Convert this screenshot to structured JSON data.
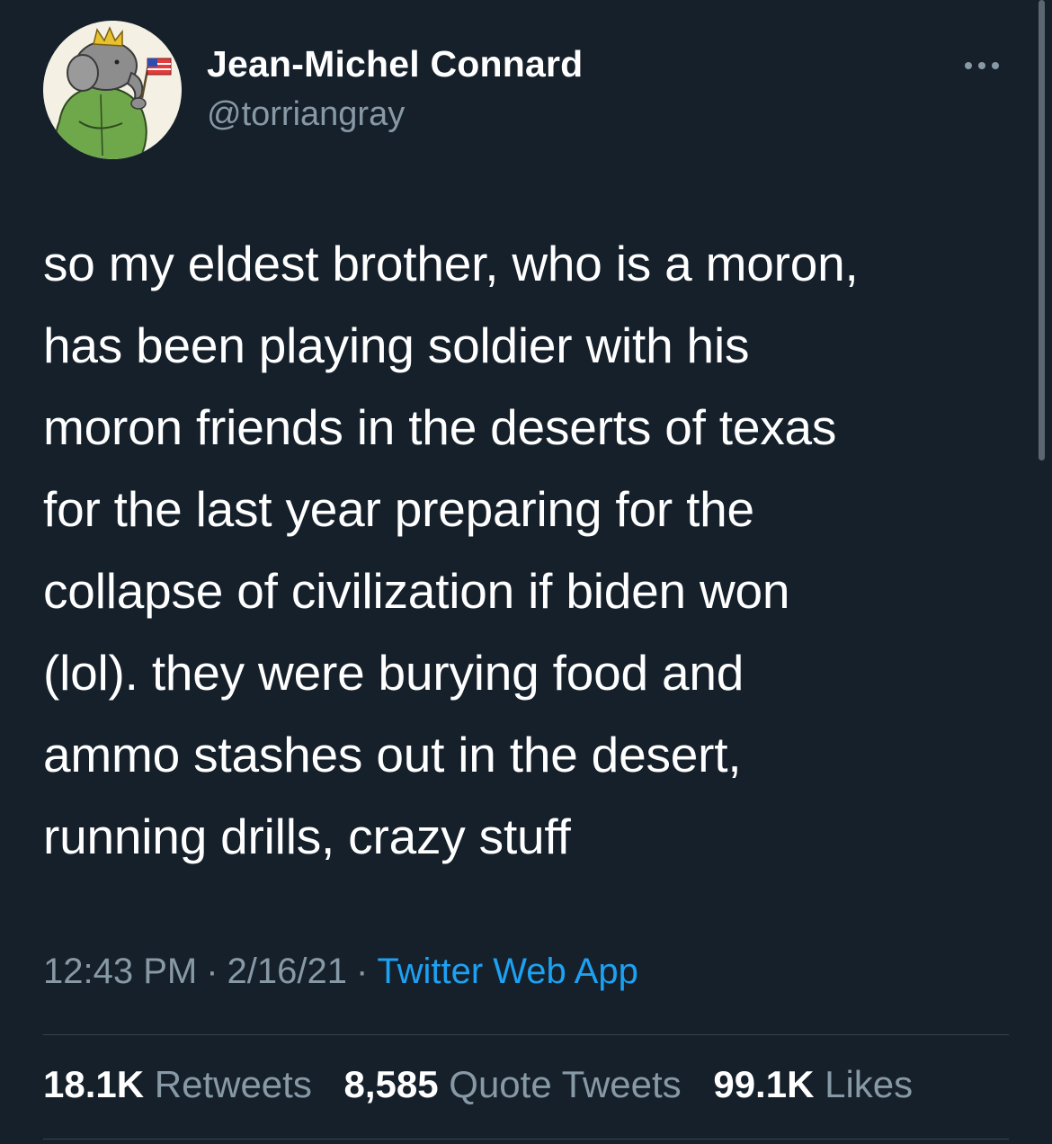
{
  "author": {
    "display_name": "Jean-Michel Connard",
    "handle": "@torriangray",
    "avatar_icon": "elephant-king-avatar"
  },
  "tweet": {
    "lines": [
      "so my eldest brother, who is a moron,",
      "has been playing soldier with his",
      "moron friends in the deserts of texas",
      "for the last year preparing for the",
      "collapse of civilization if biden won",
      "(lol). they were burying food and",
      "ammo stashes out in the desert,",
      "running drills, crazy stuff"
    ]
  },
  "meta": {
    "time": "12:43 PM",
    "separator": "·",
    "date": "2/16/21",
    "source": "Twitter Web App"
  },
  "stats": {
    "retweets_count": "18.1K",
    "retweets_label": "Retweets",
    "quote_count": "8,585",
    "quote_label": "Quote Tweets",
    "likes_count": "99.1K",
    "likes_label": "Likes"
  },
  "colors": {
    "background": "#15202b",
    "text": "#ffffff",
    "secondary": "#8899a6",
    "link": "#1da1f2",
    "divider": "#38444d"
  },
  "icons": {
    "more": "more-horizontal-icon"
  }
}
